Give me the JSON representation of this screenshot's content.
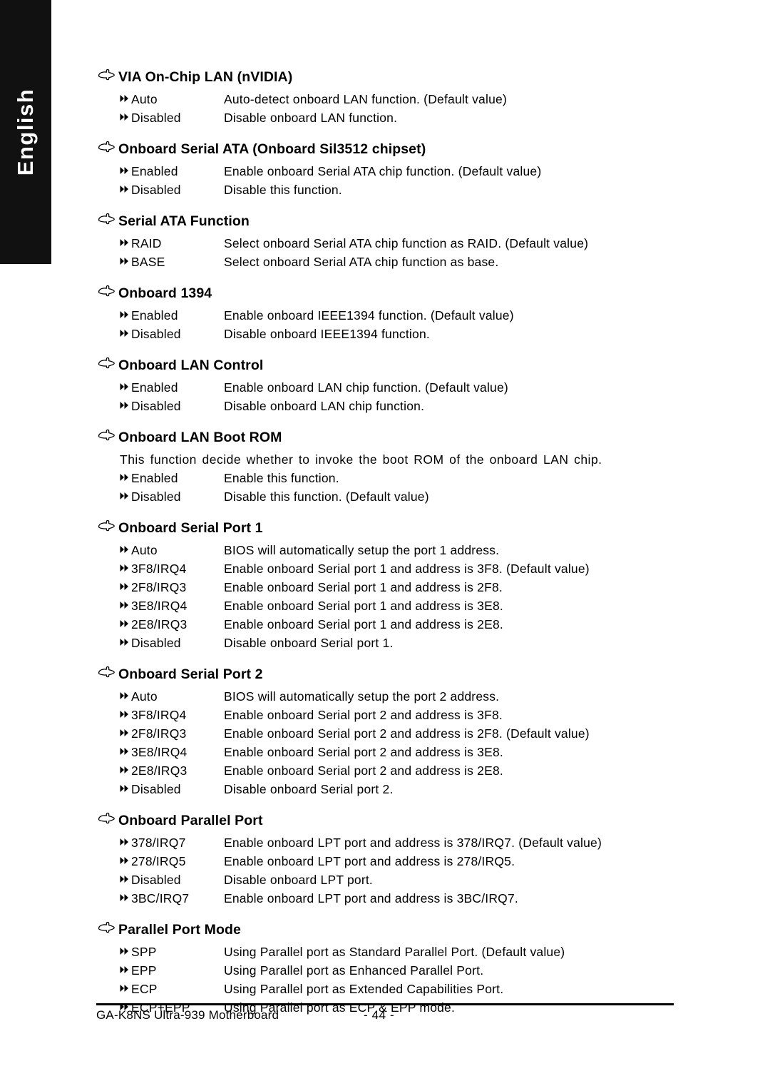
{
  "language_tab": {
    "label": "English"
  },
  "icons": {
    "heading_bullet": "pointing-hand-icon",
    "option_bullet": "double-triangle-icon"
  },
  "sections": [
    {
      "title": "VIA On-Chip LAN (nVIDIA)",
      "note": null,
      "options": [
        {
          "label": "Auto",
          "desc": "Auto-detect onboard LAN function. (Default value)"
        },
        {
          "label": "Disabled",
          "desc": "Disable onboard LAN function."
        }
      ]
    },
    {
      "title": "Onboard Serial ATA (Onboard Sil3512 chipset)",
      "note": null,
      "options": [
        {
          "label": "Enabled",
          "desc": "Enable onboard Serial ATA chip function. (Default value)"
        },
        {
          "label": "Disabled",
          "desc": "Disable this function."
        }
      ]
    },
    {
      "title": "Serial ATA Function",
      "note": null,
      "options": [
        {
          "label": "RAID",
          "desc": "Select onboard Serial ATA chip function as RAID. (Default value)"
        },
        {
          "label": "BASE",
          "desc": "Select onboard Serial ATA chip function as base."
        }
      ]
    },
    {
      "title": "Onboard 1394",
      "note": null,
      "options": [
        {
          "label": "Enabled",
          "desc": "Enable onboard IEEE1394 function. (Default value)"
        },
        {
          "label": "Disabled",
          "desc": "Disable onboard IEEE1394 function."
        }
      ]
    },
    {
      "title": "Onboard LAN Control",
      "note": null,
      "options": [
        {
          "label": "Enabled",
          "desc": "Enable onboard LAN chip function. (Default value)"
        },
        {
          "label": "Disabled",
          "desc": "Disable onboard LAN chip function."
        }
      ]
    },
    {
      "title": "Onboard LAN Boot ROM",
      "note": "This function decide whether to invoke the boot ROM of the onboard LAN chip.",
      "options": [
        {
          "label": "Enabled",
          "desc": "Enable this function."
        },
        {
          "label": "Disabled",
          "desc": "Disable this function. (Default value)"
        }
      ]
    },
    {
      "title": "Onboard Serial Port 1",
      "note": null,
      "options": [
        {
          "label": "Auto",
          "desc": "BIOS will automatically setup the port 1 address."
        },
        {
          "label": "3F8/IRQ4",
          "desc": "Enable onboard Serial port 1 and address is 3F8. (Default value)"
        },
        {
          "label": "2F8/IRQ3",
          "desc": "Enable onboard Serial port 1 and address is 2F8."
        },
        {
          "label": "3E8/IRQ4",
          "desc": "Enable onboard Serial port 1 and address is 3E8."
        },
        {
          "label": "2E8/IRQ3",
          "desc": "Enable onboard Serial port 1 and address is 2E8."
        },
        {
          "label": "Disabled",
          "desc": "Disable onboard Serial port 1."
        }
      ]
    },
    {
      "title": "Onboard Serial Port 2",
      "note": null,
      "options": [
        {
          "label": "Auto",
          "desc": "BIOS will automatically setup the port 2 address."
        },
        {
          "label": "3F8/IRQ4",
          "desc": "Enable onboard Serial port 2 and address is 3F8."
        },
        {
          "label": "2F8/IRQ3",
          "desc": "Enable onboard Serial port 2 and address is 2F8. (Default value)"
        },
        {
          "label": "3E8/IRQ4",
          "desc": "Enable onboard Serial port 2 and address is 3E8."
        },
        {
          "label": "2E8/IRQ3",
          "desc": "Enable onboard Serial port 2 and address is 2E8."
        },
        {
          "label": "Disabled",
          "desc": "Disable onboard Serial port 2."
        }
      ]
    },
    {
      "title": "Onboard Parallel Port",
      "note": null,
      "options": [
        {
          "label": "378/IRQ7",
          "desc": "Enable onboard LPT port and address is 378/IRQ7. (Default value)"
        },
        {
          "label": "278/IRQ5",
          "desc": "Enable onboard LPT port and address is 278/IRQ5."
        },
        {
          "label": "Disabled",
          "desc": "Disable onboard LPT port."
        },
        {
          "label": "3BC/IRQ7",
          "desc": "Enable onboard LPT port and address is 3BC/IRQ7."
        }
      ]
    },
    {
      "title": "Parallel Port Mode",
      "note": null,
      "options": [
        {
          "label": "SPP",
          "desc": "Using Parallel port as Standard Parallel Port. (Default value)"
        },
        {
          "label": "EPP",
          "desc": "Using Parallel port as Enhanced Parallel Port."
        },
        {
          "label": "ECP",
          "desc": "Using Parallel port as Extended Capabilities Port."
        },
        {
          "label": "ECP+EPP",
          "desc": "Using Parallel port as ECP & EPP mode."
        }
      ]
    }
  ],
  "footer": {
    "document_title": "GA-K8NS Ultra-939 Motherboard",
    "page_number": "- 44 -"
  }
}
